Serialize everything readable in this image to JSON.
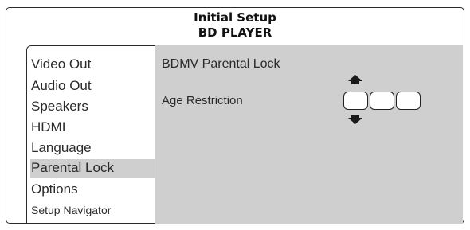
{
  "header": {
    "title": "Initial Setup",
    "subtitle": "BD PLAYER"
  },
  "menu": {
    "items": [
      {
        "label": "Video Out"
      },
      {
        "label": "Audio Out"
      },
      {
        "label": "Speakers"
      },
      {
        "label": "HDMI"
      },
      {
        "label": "Language"
      },
      {
        "label": "Parental Lock",
        "selected": true
      },
      {
        "label": "Options"
      },
      {
        "label": "Setup Navigator"
      }
    ]
  },
  "panel": {
    "heading": "BDMV Parental Lock",
    "field_label": "Age Restriction",
    "digits": [
      "",
      "",
      ""
    ],
    "up_icon": "arrow-up-icon",
    "down_icon": "arrow-down-icon"
  },
  "colors": {
    "highlight": "#cfcfcf",
    "border": "#2a2a2a"
  }
}
